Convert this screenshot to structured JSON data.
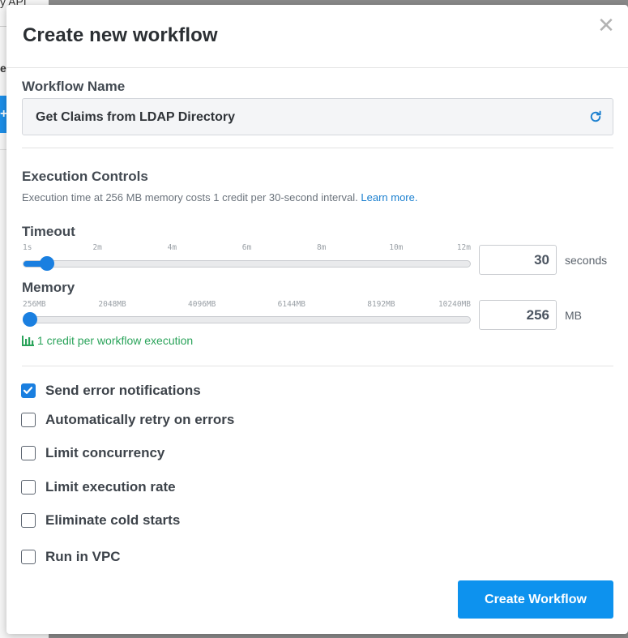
{
  "background": {
    "partial_text": "y API",
    "partial_heading": "e",
    "button_glyph": "+"
  },
  "modal": {
    "title": "Create new workflow",
    "close_glyph": "✕",
    "workflow_name": {
      "label": "Workflow Name",
      "value": "Get Claims from LDAP Directory",
      "refresh_icon": "refresh-icon"
    },
    "execution": {
      "heading": "Execution Controls",
      "description": "Execution time at 256 MB memory costs 1 credit per 30-second interval.",
      "link": "Learn more.",
      "timeout": {
        "label": "Timeout",
        "ticks": [
          "1s",
          "2m",
          "4m",
          "6m",
          "8m",
          "10m",
          "12m"
        ],
        "value": "30",
        "unit": "seconds",
        "slider_fraction": 0.04
      },
      "memory": {
        "label": "Memory",
        "ticks": [
          "256MB",
          "2048MB",
          "4096MB",
          "6144MB",
          "8192MB",
          "10240MB"
        ],
        "value": "256",
        "unit": "MB",
        "slider_fraction": 0.0
      },
      "credit_note": "1 credit per workflow execution"
    },
    "options": [
      {
        "label": "Send error notifications",
        "checked": true
      },
      {
        "label": "Automatically retry on errors",
        "checked": false
      },
      {
        "label": "Limit concurrency",
        "checked": false
      },
      {
        "label": "Limit execution rate",
        "checked": false
      },
      {
        "label": "Eliminate cold starts",
        "checked": false
      },
      {
        "label": "Run in VPC",
        "checked": false
      }
    ],
    "submit_label": "Create Workflow"
  },
  "colors": {
    "accent": "#1a7fe0",
    "button": "#0d92ee",
    "success": "#2aa35a",
    "link": "#1a7fcf"
  }
}
